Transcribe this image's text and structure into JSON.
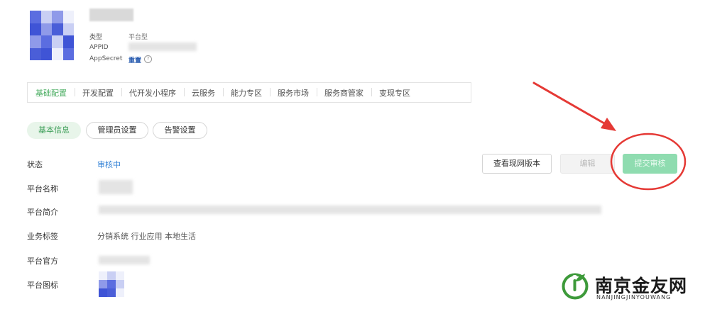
{
  "header": {
    "type_label": "类型",
    "type_value": "平台型",
    "appid_label": "APPID",
    "appsecret_label": "AppSecret",
    "appsecret_value": "重置",
    "help_icon": "question-circle-icon",
    "avatar_colors": [
      "#5b6de0",
      "#8f9ae9",
      "#c9cff4",
      "#eef0fb",
      "#3f54d6",
      "#4a5ed8"
    ]
  },
  "main_nav": {
    "tabs": [
      "基础配置",
      "开发配置",
      "代开发小程序",
      "云服务",
      "能力专区",
      "服务市场",
      "服务商管家",
      "变现专区"
    ],
    "active_index": 0
  },
  "sub_tabs": {
    "tabs": [
      "基本信息",
      "管理员设置",
      "告警设置"
    ],
    "active_index": 0
  },
  "form": {
    "status_label": "状态",
    "status_value": "审核中",
    "name_label": "平台名称",
    "intro_label": "平台简介",
    "tags_label": "业务标签",
    "tags_value": "分销系统 行业应用 本地生活",
    "site_label": "平台官方",
    "icon_label": "平台图标"
  },
  "actions": {
    "view_version": "查看现网版本",
    "edit": "编辑",
    "submit_review": "提交审核"
  },
  "colors": {
    "accent_green": "#4cae63",
    "link_blue": "#2e7fd6",
    "annotation_red": "#e53935",
    "submit_disabled": "#8fdcb0"
  },
  "watermark": {
    "title": "南京金友网",
    "subtitle": "NANJINGJINYOUWANG"
  }
}
